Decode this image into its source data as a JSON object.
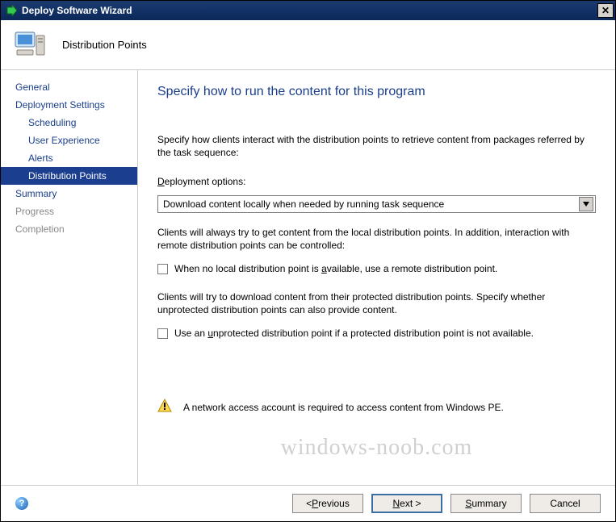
{
  "window": {
    "title": "Deploy Software Wizard",
    "close": "✕"
  },
  "header": {
    "page_title": "Distribution Points"
  },
  "sidebar": {
    "items": [
      {
        "label": "General"
      },
      {
        "label": "Deployment Settings"
      },
      {
        "label": "Scheduling"
      },
      {
        "label": "User Experience"
      },
      {
        "label": "Alerts"
      },
      {
        "label": "Distribution Points"
      },
      {
        "label": "Summary"
      },
      {
        "label": "Progress"
      },
      {
        "label": "Completion"
      }
    ]
  },
  "main": {
    "heading": "Specify how to run the content for this program",
    "intro": "Specify how clients interact with the distribution points to retrieve content from packages referred by the task sequence:",
    "options_label_pre": "D",
    "options_label_rest": "eployment options:",
    "dropdown_value": "Download content locally when needed by running task sequence",
    "para2": "Clients will always try to get content from the local distribution points. In addition, interaction with remote distribution points can be controlled:",
    "check1_pre": "When no local distribution point is ",
    "check1_u": "a",
    "check1_post": "vailable, use a remote distribution point.",
    "para3": "Clients will try to download content from their protected distribution points. Specify whether unprotected distribution points can also provide content.",
    "check2_pre": "Use an ",
    "check2_u": "u",
    "check2_post": "nprotected distribution point if a protected distribution point is not available.",
    "warning": "A network access account is required to access content from Windows PE."
  },
  "footer": {
    "previous_u": "P",
    "previous_rest": "revious",
    "next_u": "N",
    "next_rest": "ext >",
    "summary_u": "S",
    "summary_rest": "ummary",
    "cancel": "Cancel"
  },
  "watermark": "windows-noob.com"
}
